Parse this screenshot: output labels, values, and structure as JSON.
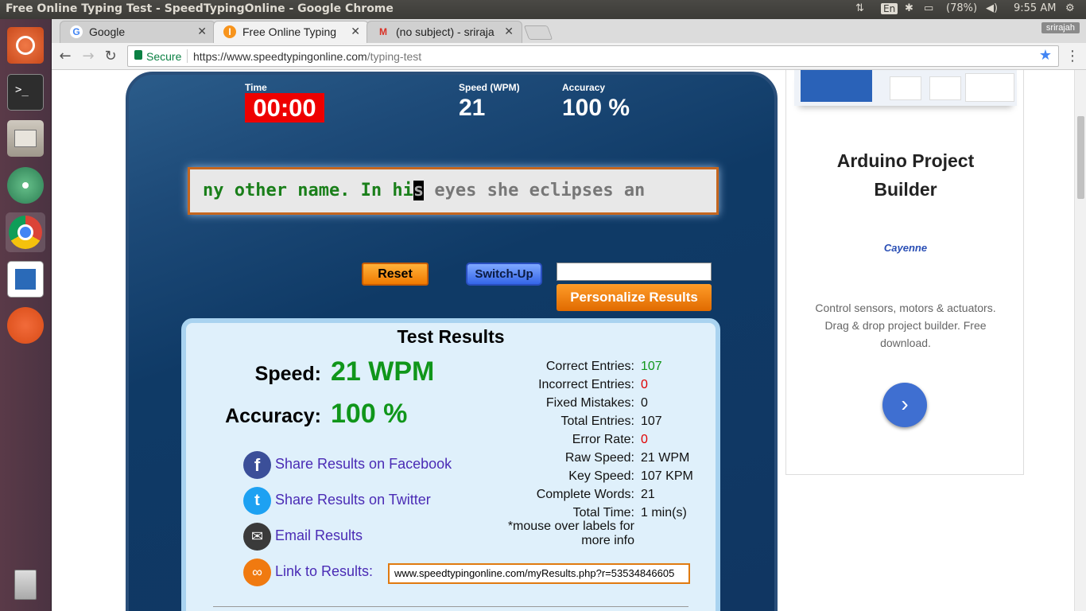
{
  "os": {
    "window_title": "Free Online Typing Test - SpeedTypingOnline - Google Chrome",
    "keyboard_layout": "En",
    "battery": "(78%)",
    "clock": "9:55 AM"
  },
  "browser": {
    "tabs": [
      {
        "label": "Google",
        "favicon": "google-icon"
      },
      {
        "label": "Free Online Typing",
        "favicon": "speedtyping-icon"
      },
      {
        "label": "(no subject) - sriraja",
        "favicon": "gmail-icon"
      }
    ],
    "profile": "srirajah",
    "security_label": "Secure",
    "url_scheme_host": "https://www.speedtypingonline.com",
    "url_path": "/typing-test"
  },
  "test": {
    "time_label": "Time",
    "time_value": "00:00",
    "speed_label": "Speed (WPM)",
    "speed_value": "21",
    "accuracy_label": "Accuracy",
    "accuracy_value": "100 %",
    "text_done": "ny other name. In hi",
    "text_cursor": "s",
    "text_todo": " eyes she eclipses an",
    "reset_label": "Reset",
    "switchup_label": "Switch-Up",
    "personalize_label": "Personalize Results"
  },
  "results": {
    "title": "Test Results",
    "speed_label": "Speed:",
    "speed_value": "21 WPM",
    "accuracy_label": "Accuracy:",
    "accuracy_value": "100 %",
    "share_facebook": "Share Results on Facebook",
    "share_twitter": "Share Results on Twitter",
    "email": "Email Results",
    "link_label": "Link to Results:",
    "link_value": "www.speedtypingonline.com/myResults.php?r=53534846605",
    "stats": [
      {
        "label": "Correct Entries:",
        "value": "107",
        "color": "#10961a"
      },
      {
        "label": "Incorrect Entries:",
        "value": "0",
        "color": "#e00000"
      },
      {
        "label": "Fixed Mistakes:",
        "value": "0",
        "color": "#111111"
      },
      {
        "label": "Total Entries:",
        "value": "107",
        "color": "#111111"
      },
      {
        "label": "Error Rate:",
        "value": "0",
        "color": "#e00000"
      },
      {
        "label": "Raw Speed:",
        "value": "21 WPM",
        "color": "#111111"
      },
      {
        "label": "Key Speed:",
        "value": "107 KPM",
        "color": "#111111"
      },
      {
        "label": "Complete Words:",
        "value": "21",
        "color": "#111111"
      },
      {
        "label": "Total Time:",
        "value": "1 min(s)",
        "color": "#111111"
      }
    ],
    "note_line1": "*mouse over labels for",
    "note_line2": "more info"
  },
  "ad": {
    "title_line1": "Arduino Project",
    "title_line2": "Builder",
    "brand": "Cayenne",
    "description": "Control sensors, motors & actuators. Drag & drop project builder. Free download.",
    "cta_icon": "chevron-right-icon"
  }
}
